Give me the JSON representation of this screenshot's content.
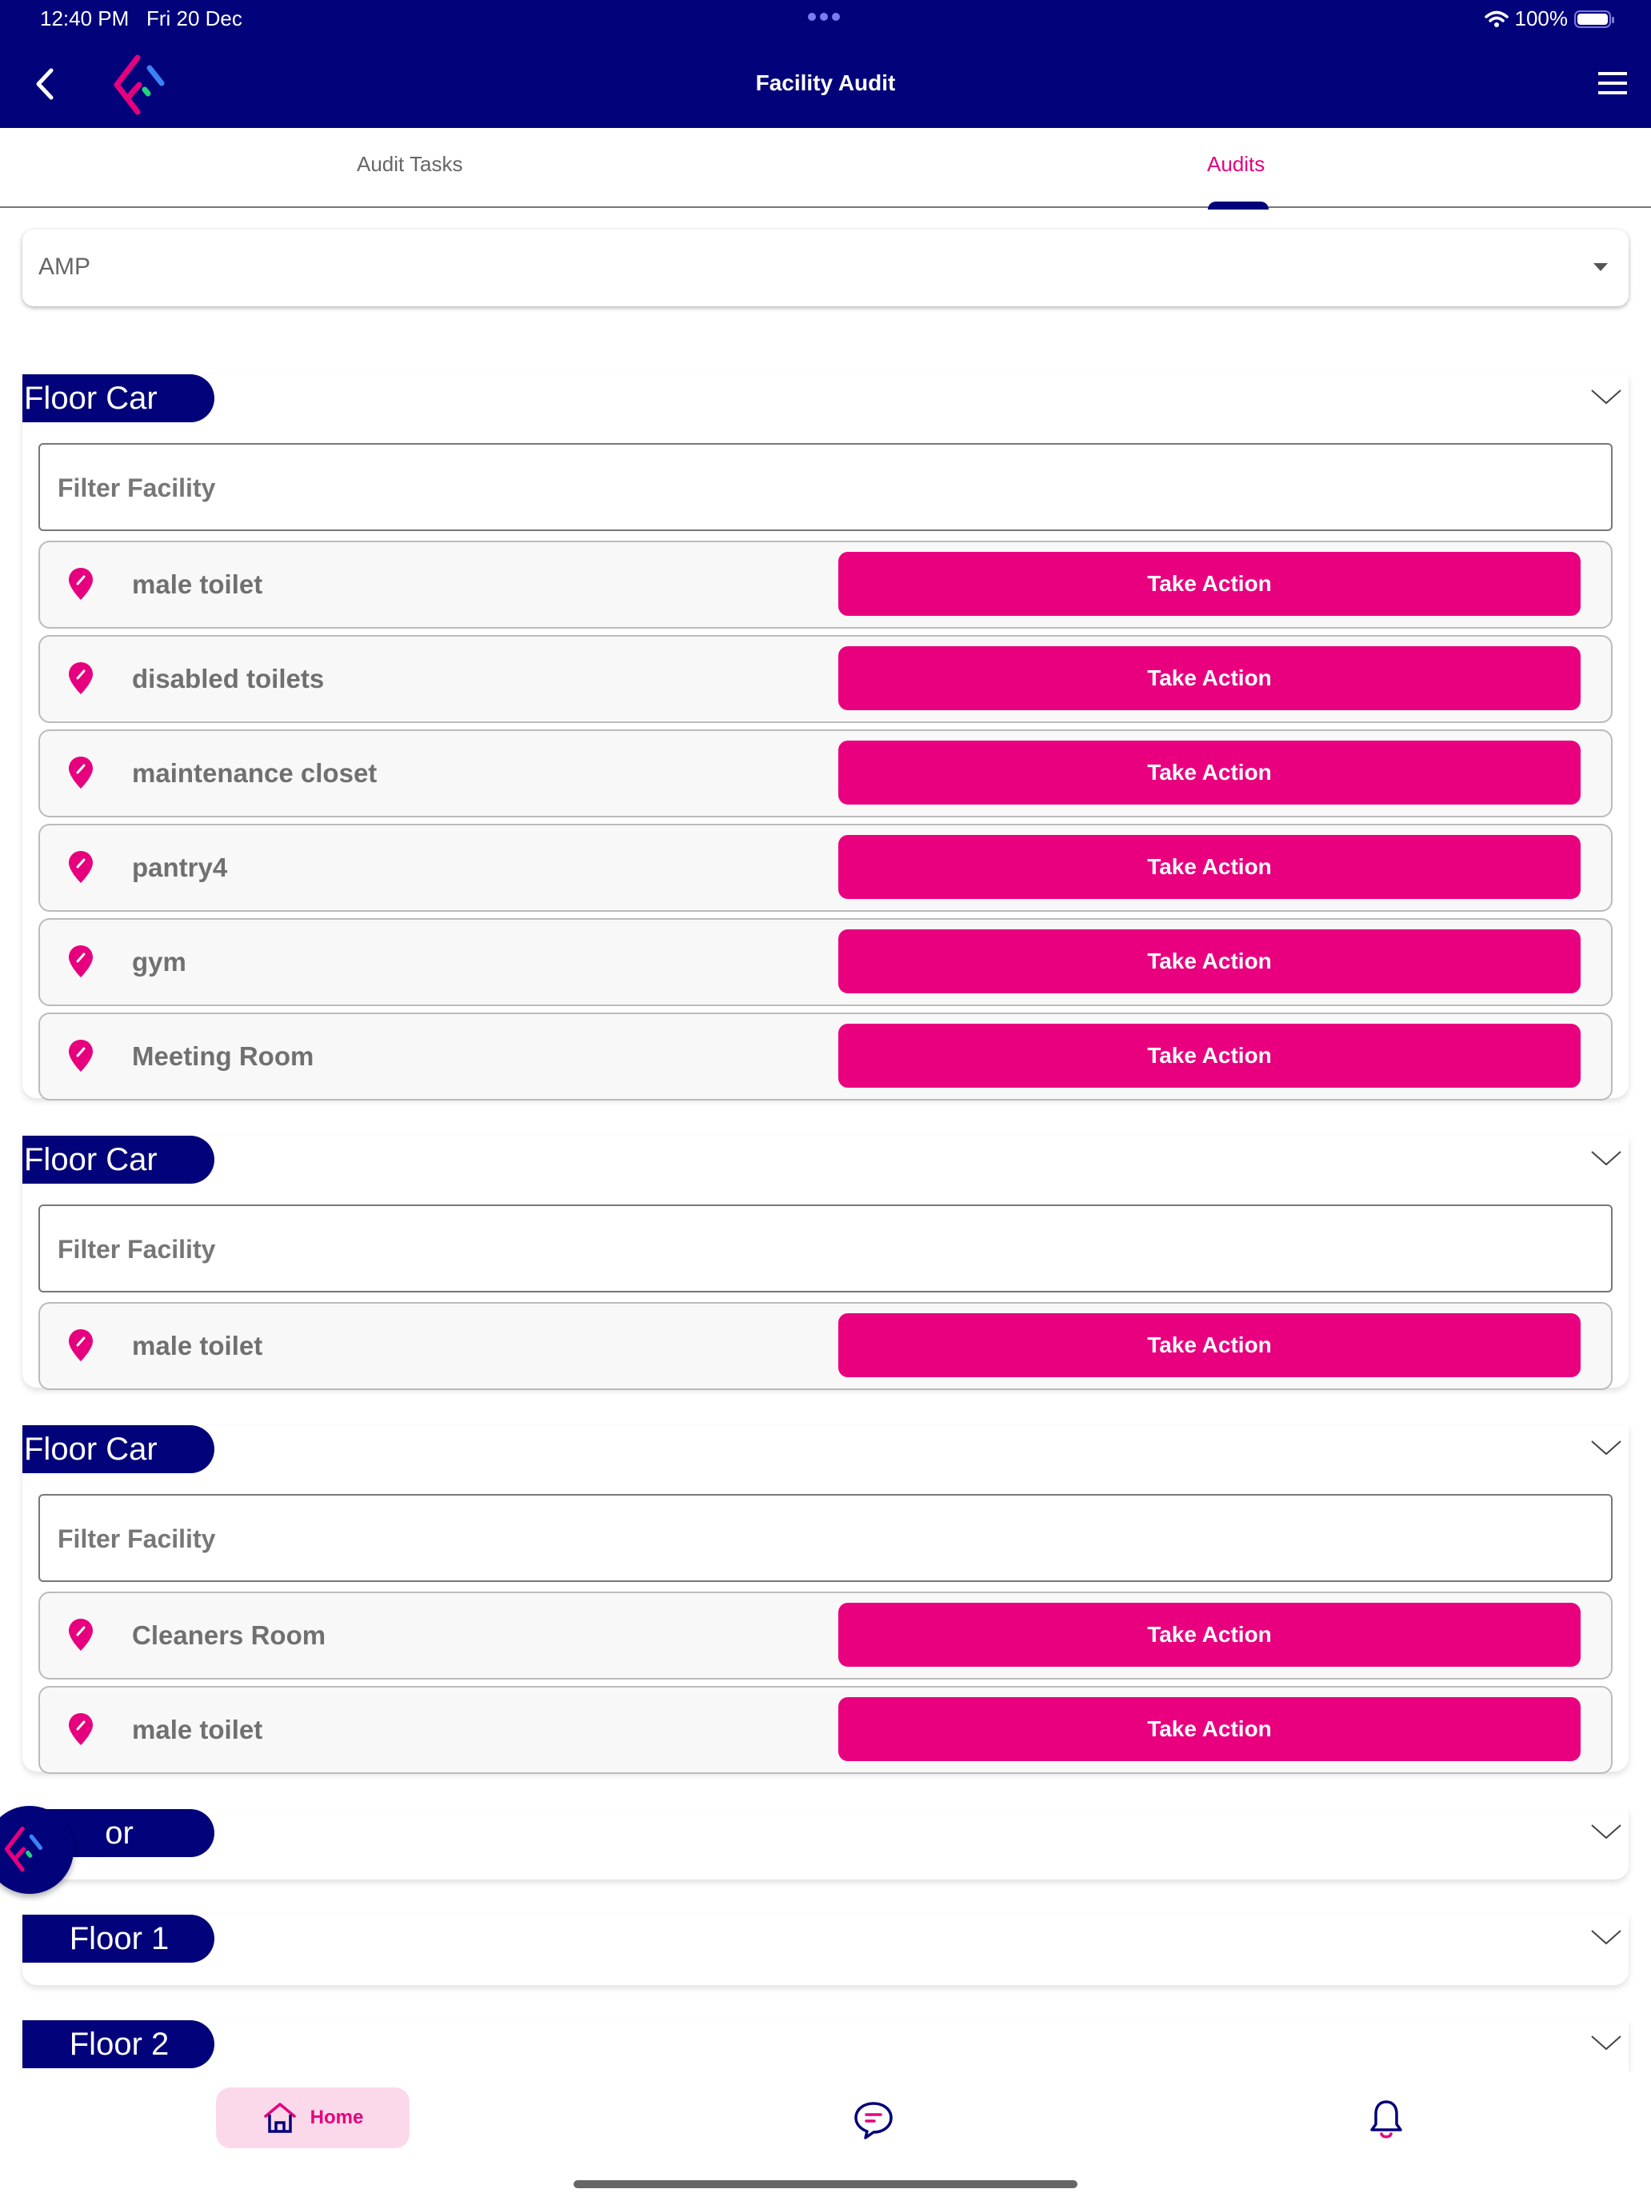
{
  "status_bar": {
    "time": "12:40 PM",
    "date": "Fri 20 Dec",
    "battery": "100%"
  },
  "header": {
    "title": "Facility Audit",
    "back_icon": "chevron-left-icon",
    "logo": "app-logo",
    "menu_icon": "hamburger-menu-icon"
  },
  "tabs": [
    {
      "label": "Audit Tasks",
      "active": false
    },
    {
      "label": "Audits",
      "active": true
    }
  ],
  "site_selector": {
    "value": "AMP"
  },
  "filter_placeholder": "Filter Facility",
  "action_label": "Take Action",
  "sections": [
    {
      "floor": "Floor Car",
      "expanded": true,
      "facilities": [
        "male toilet",
        "disabled toilets",
        "maintenance closet",
        "pantry4",
        "gym",
        "Meeting Room"
      ]
    },
    {
      "floor": "Floor Car",
      "expanded": true,
      "facilities": [
        "male toilet"
      ]
    },
    {
      "floor": "Floor Car",
      "expanded": true,
      "facilities": [
        "Cleaners Room",
        "male toilet"
      ]
    },
    {
      "floor": "or",
      "expanded": false,
      "facilities": []
    },
    {
      "floor": "Floor 1",
      "expanded": false,
      "facilities": []
    },
    {
      "floor": "Floor 2",
      "expanded": false,
      "facilities": []
    }
  ],
  "bottom_nav": {
    "home_label": "Home",
    "items": [
      "home-icon",
      "chat-icon",
      "bell-icon"
    ]
  },
  "colors": {
    "primary": "#02027a",
    "accent": "#e8007f",
    "home_bg": "#fcd9ea"
  }
}
